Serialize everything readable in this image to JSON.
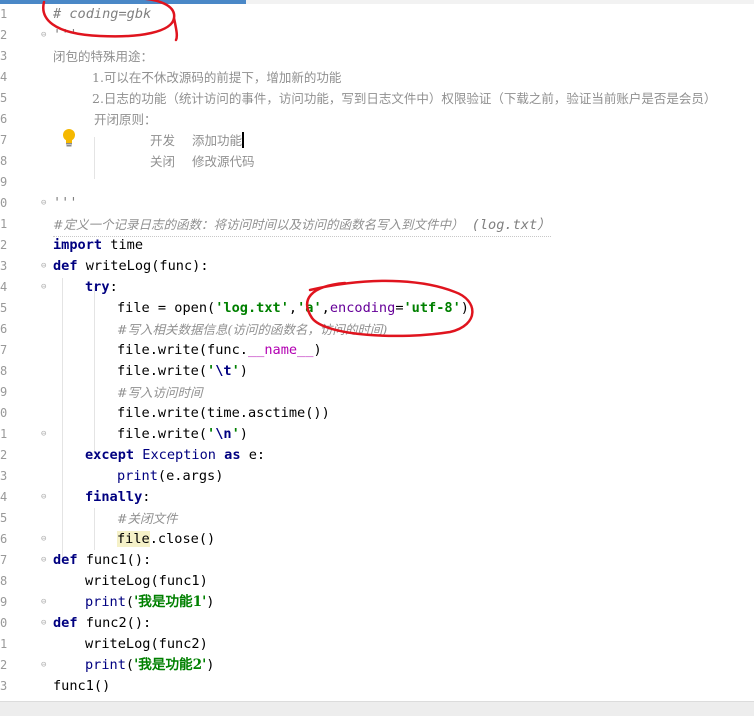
{
  "editor": {
    "line_numbers": [
      "1",
      "2",
      "3",
      "4",
      "5",
      "6",
      "7",
      "8",
      "9",
      "0",
      "1",
      "2",
      "3",
      "4",
      "5",
      "6",
      "7",
      "8",
      "9",
      "0",
      "1",
      "2",
      "3",
      "4",
      "5",
      "6",
      "7",
      "8",
      "9",
      "0",
      "1",
      "2",
      "3"
    ],
    "lines": {
      "l1": "# coding=gbk",
      "l2": "'''",
      "l3": "闭包的特殊用途：",
      "l4": "1.可以在不休改源码的前提下，增加新的功能",
      "l5": "2.日志的功能（统计访问的事件，访问功能，写到日志文件中）权限验证（下载之前，验证当前账户是否是会员）",
      "l6": "开闭原则：",
      "l7a": "开发",
      "l7b": "添加功能",
      "l8a": "关闭",
      "l8b": "修改源代码",
      "l10": "'''",
      "l11a": "#定义一个记录日志的函数：将访问时间以及访问的函数名写入到文件中）",
      "l11b": "(log.txt）",
      "l12a": "import",
      "l12b": " time",
      "l13a": "def",
      "l13b": " writeLog(func):",
      "l14": "try",
      "l14c": ":",
      "l15a": "file = open(",
      "l15b": "'log.txt'",
      "l15c": ",",
      "l15d": "'a'",
      "l15e": ",",
      "l15f": "encoding",
      "l15g": "=",
      "l15h": "'utf-8'",
      "l15i": ")",
      "l16a": "#写入相关数据信息(访问的函数名，访问的时间)",
      "l17a": "file.write(func.",
      "l17b": "__name__",
      "l17c": ")",
      "l18a": "file.write(",
      "l18b": "'",
      "l18c": "\\t",
      "l18d": "'",
      "l18e": ")",
      "l19": "#写入访问时间",
      "l20": "file.write(time.asctime())",
      "l21a": "file.write(",
      "l21b": "'",
      "l21c": "\\n",
      "l21d": "'",
      "l21e": ")",
      "l22a": "except",
      "l22b": " Exception ",
      "l22c": "as",
      "l22d": " e:",
      "l23a": "print",
      "l23b": "(e.args)",
      "l24a": "finally",
      "l24b": ":",
      "l25": "#关闭文件",
      "l26a": "file",
      "l26b": ".close()",
      "l27a": "def",
      "l27b": " func1():",
      "l28": "writeLog(func1)",
      "l29a": "print",
      "l29b": "(",
      "l29c": "'我是功能1'",
      "l29d": ")",
      "l30a": "def",
      "l30b": " func2():",
      "l31": "writeLog(func2)",
      "l32a": "print",
      "l32b": "(",
      "l32c": "'我是功能2'",
      "l32d": ")",
      "l33": "func1()"
    }
  },
  "colors": {
    "keyword": "#000080",
    "string": "#008000",
    "comment": "#808080",
    "magic": "#b200b2",
    "annotation": "#e0141e"
  },
  "icons": {
    "intention": "lightbulb-icon"
  }
}
